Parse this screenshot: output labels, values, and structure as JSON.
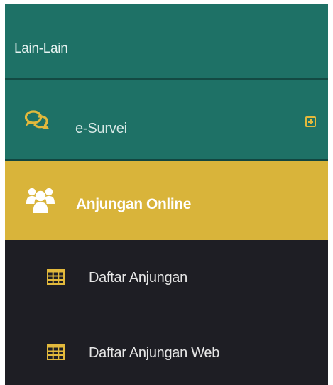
{
  "sidebar": {
    "section_header": "Lain-Lain",
    "items": [
      {
        "label": "e-Survei",
        "icon": "comments-icon",
        "expand_icon": "plus-square-icon"
      },
      {
        "label": "Anjungan Online",
        "icon": "users-icon",
        "active": true
      }
    ],
    "submenu": [
      {
        "label": "Daftar Anjungan",
        "icon": "table-icon"
      },
      {
        "label": "Daftar Anjungan Web",
        "icon": "table-icon"
      }
    ]
  },
  "colors": {
    "teal": "#1e7166",
    "gold": "#d9b43a",
    "dark": "#1e1e24",
    "icon_gold": "#e2b93c"
  }
}
